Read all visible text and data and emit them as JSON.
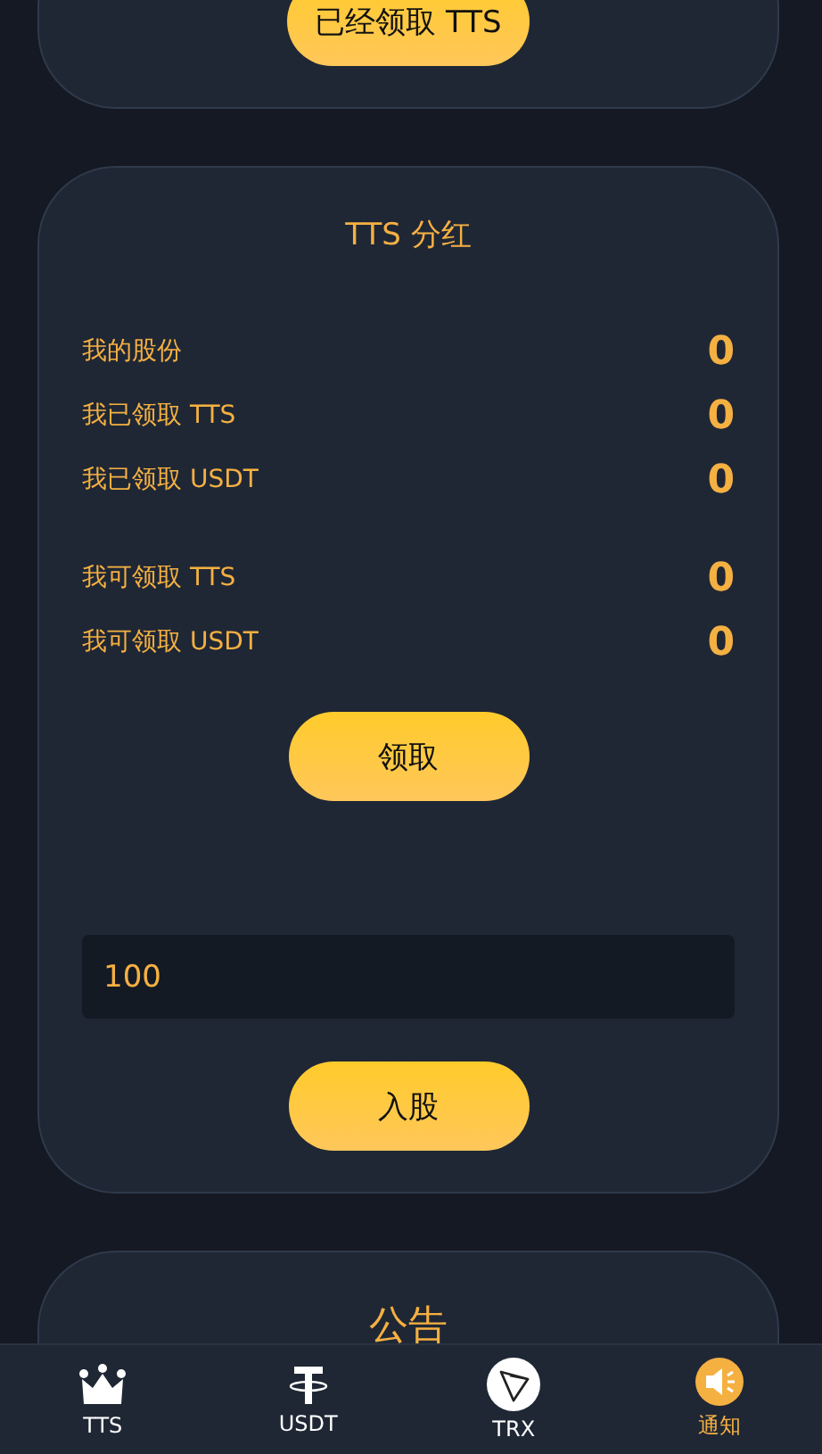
{
  "top_card": {
    "button": "已经领取 TTS"
  },
  "dividend": {
    "title": "TTS 分红",
    "row_groups": [
      [
        {
          "label": "我的股份",
          "value": "0"
        },
        {
          "label": "我已领取 TTS",
          "value": "0"
        },
        {
          "label": "我已领取 USDT",
          "value": "0"
        }
      ],
      [
        {
          "label": "我可领取 TTS",
          "value": "0"
        },
        {
          "label": "我可领取 USDT",
          "value": "0"
        }
      ]
    ],
    "claim_button": "领取",
    "amount_field": {
      "value": "100"
    },
    "join_button": "入股"
  },
  "notice": {
    "title": "公告"
  },
  "nav": [
    {
      "kind": "crown",
      "label": "TTS",
      "selected": false
    },
    {
      "kind": "tether",
      "label": "USDT",
      "selected": false
    },
    {
      "kind": "tron",
      "label": "TRX",
      "selected": false
    },
    {
      "kind": "speaker",
      "label": "通知",
      "selected": true
    }
  ]
}
